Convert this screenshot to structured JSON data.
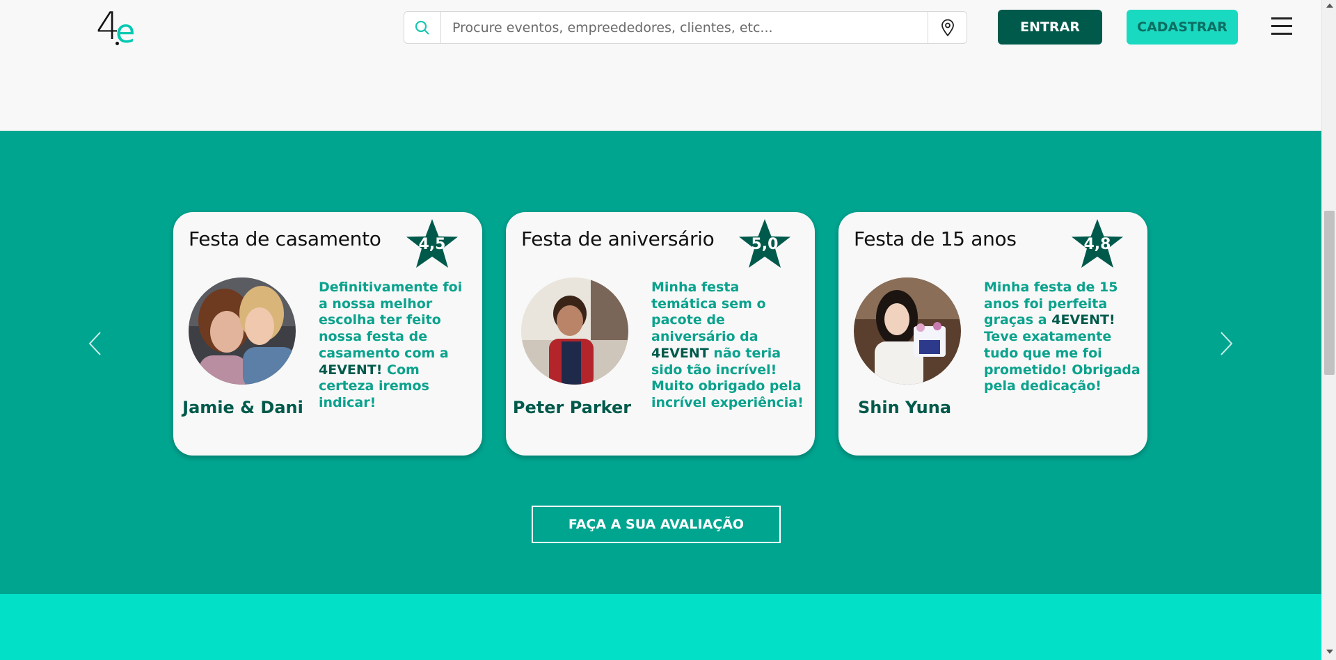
{
  "header": {
    "search_placeholder": "Procure eventos, empreededores, clientes, etc...",
    "login_label": "ENTRAR",
    "signup_label": "CADASTRAR"
  },
  "carousel": {
    "cards": [
      {
        "title": "Festa de casamento",
        "rating": "4,5",
        "name": "Jamie & Dani",
        "text_before": "Definitivamente foi a nossa melhor escolha ter feito nossa festa de casamento com a ",
        "brand": "4EVENT!",
        "text_after": " Com certeza iremos indicar!"
      },
      {
        "title": "Festa de aniversário",
        "rating": "5,0",
        "name": "Peter Parker",
        "text_before": "Minha festa temática sem o pacote de aniversário da ",
        "brand": "4EVENT",
        "text_after": " não teria sido tão incrível! Muito obrigado pela incrível experiência!"
      },
      {
        "title": "Festa de 15 anos",
        "rating": "4,8",
        "name": "Shin Yuna",
        "text_before": "Minha festa de 15 anos foi perfeita graças a ",
        "brand": "4EVENT!",
        "text_after": " Teve exatamente tudo que me foi prometido! Obrigada pela dedicação!"
      }
    ],
    "review_button": "FAÇA A SUA AVALIAÇÃO"
  },
  "colors": {
    "primary_dark": "#005a4b",
    "section_bg": "#00a590",
    "accent": "#1ad9c1",
    "bottom_bg": "#03e0c8"
  }
}
